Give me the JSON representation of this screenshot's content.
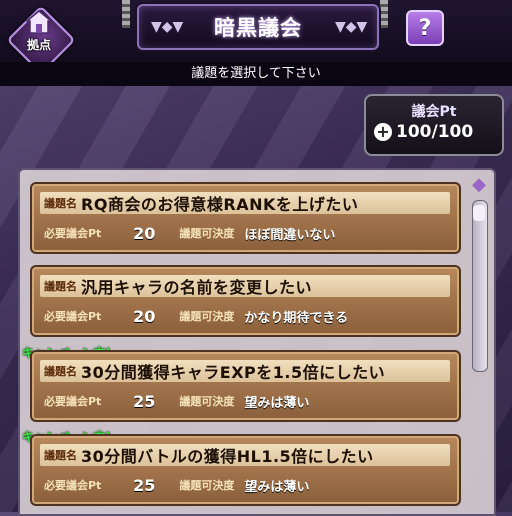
{
  "header": {
    "title": "暗黒議会",
    "home_label": "拠点",
    "help_label": "?"
  },
  "instruction": "議題を選択して下さい",
  "council_pt": {
    "label": "議会Pt",
    "value": "100/100"
  },
  "labels": {
    "agenda": "議題名",
    "required": "必要議会Pt",
    "probability": "議題可決度"
  },
  "campaign_label": "キャンペーン中!",
  "agendas": [
    {
      "title": "RQ商会のお得意様RANKを上げたい",
      "required": "20",
      "probability": "ほぼ間違いない",
      "campaign": false
    },
    {
      "title": "汎用キャラの名前を変更したい",
      "required": "20",
      "probability": "かなり期待できる",
      "campaign": false
    },
    {
      "title": "30分間獲得キャラEXPを1.5倍にしたい",
      "required": "25",
      "probability": "望みは薄い",
      "campaign": true
    },
    {
      "title": "30分間バトルの獲得HL1.5倍にしたい",
      "required": "25",
      "probability": "望みは薄い",
      "campaign": true
    }
  ],
  "colors": {
    "campaign": "#36e846",
    "card": "#b9885c",
    "accent": "#8c72b8"
  }
}
